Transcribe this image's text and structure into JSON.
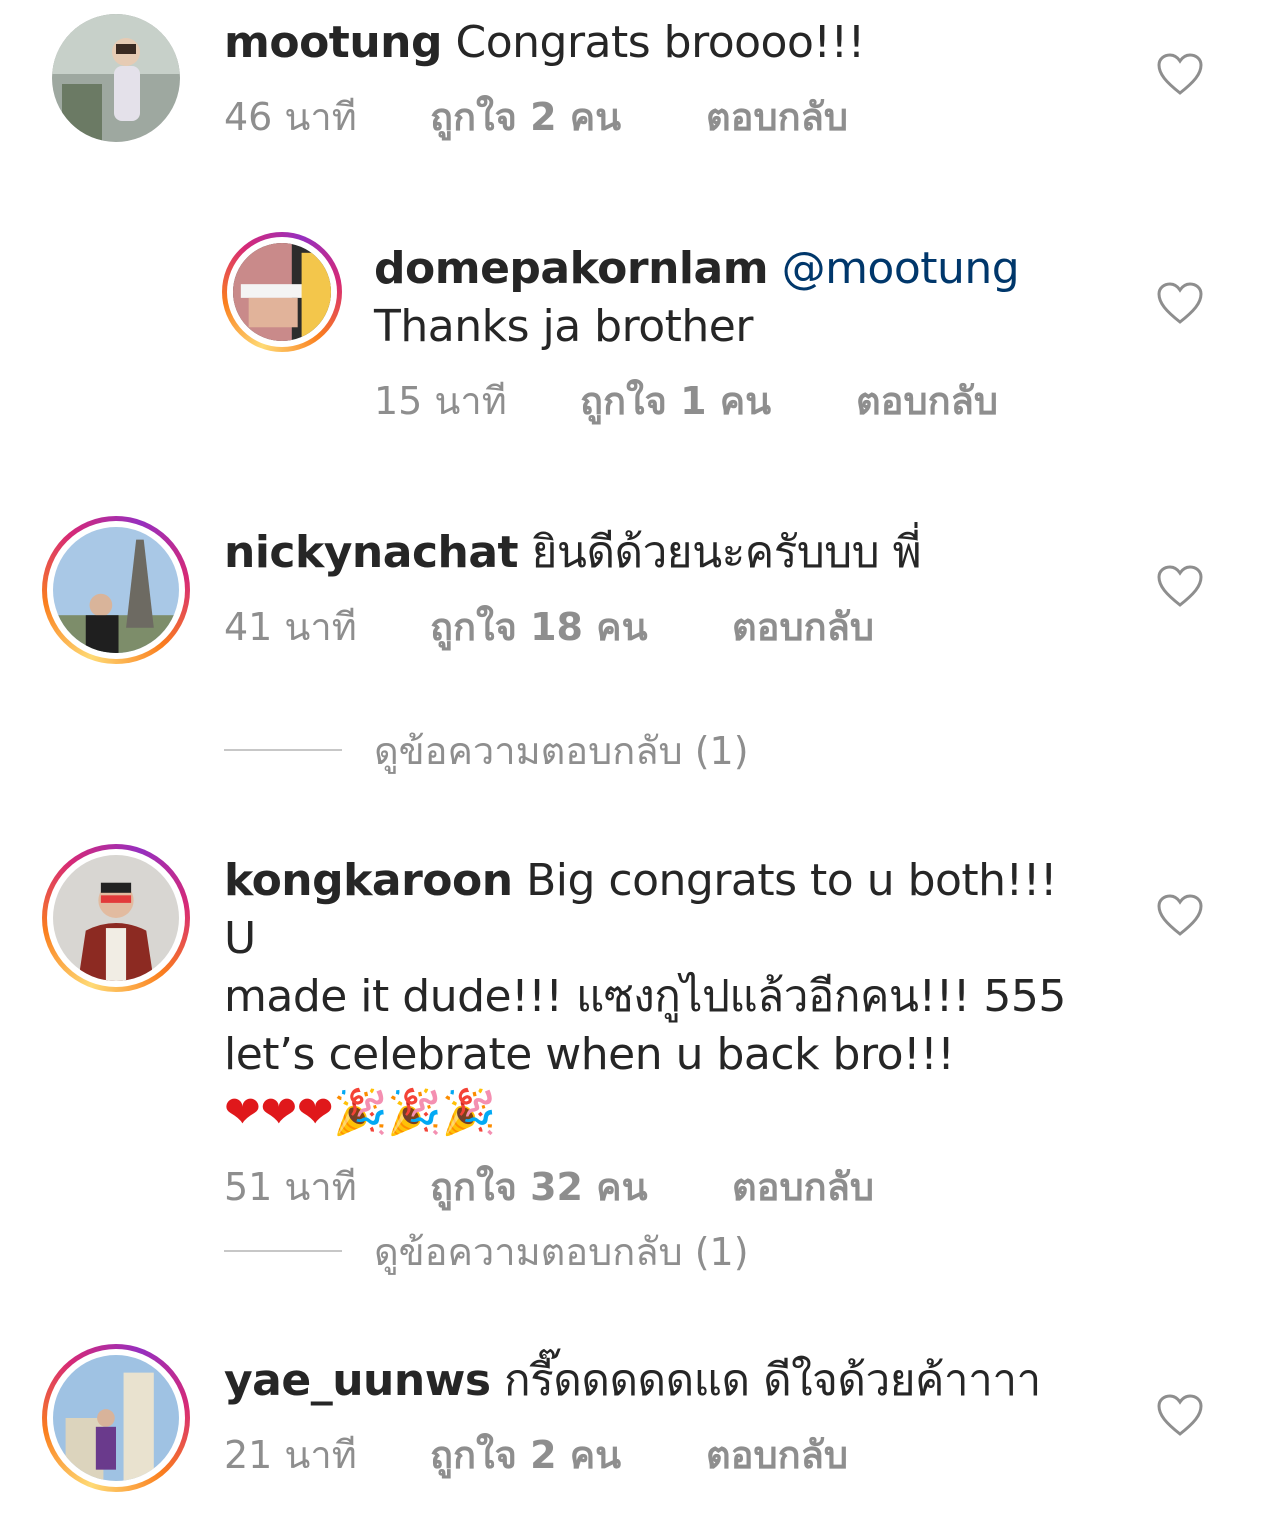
{
  "comments": [
    {
      "username": "mootung",
      "mention": "",
      "text": "Congrats broooo!!!",
      "time": "46 นาที",
      "likes": "ถูกใจ 2 คน",
      "reply": "ตอบกลับ",
      "avatar_ring": false
    },
    {
      "username": "domepakornlam",
      "mention": "@mootung",
      "text": "Thanks ja brother",
      "time": "15 นาที",
      "likes": "ถูกใจ 1 คน",
      "reply": "ตอบกลับ",
      "avatar_ring": true
    },
    {
      "username": "nickynachat",
      "mention": "",
      "text": "ยินดีด้วยนะครับบบ พี่",
      "time": "41 นาที",
      "likes": "ถูกใจ 18 คน",
      "reply": "ตอบกลับ",
      "avatar_ring": true
    },
    {
      "username": "kongkaroon",
      "mention": "",
      "text_line1": "Big congrats to u both!!! U",
      "text_line2": "made it dude!!! แซงกูไปแล้วอีกคน!!! 555",
      "text_line3": "let’s celebrate when u back bro!!!",
      "emoji_line": "❤❤❤🎉🎉🎉",
      "time": "51 นาที",
      "likes": "ถูกใจ 32 คน",
      "reply": "ตอบกลับ",
      "avatar_ring": true
    },
    {
      "username": "yae_uunws",
      "mention": "",
      "text": "กรี๊ดดดดดแด ดีใจด้วยค้าาาา",
      "time": "21 นาที",
      "likes": "ถูกใจ 2 คน",
      "reply": "ตอบกลับ",
      "avatar_ring": true
    }
  ],
  "view_replies": [
    {
      "label": "ดูข้อความตอบกลับ (1)"
    },
    {
      "label": "ดูข้อความตอบกลับ (1)"
    }
  ],
  "colors": {
    "text": "#262626",
    "muted": "#8e8e8e",
    "mention": "#00376b",
    "heart_outline": "#8e8e8e"
  },
  "icons": {
    "like": "heart-outline-icon"
  }
}
